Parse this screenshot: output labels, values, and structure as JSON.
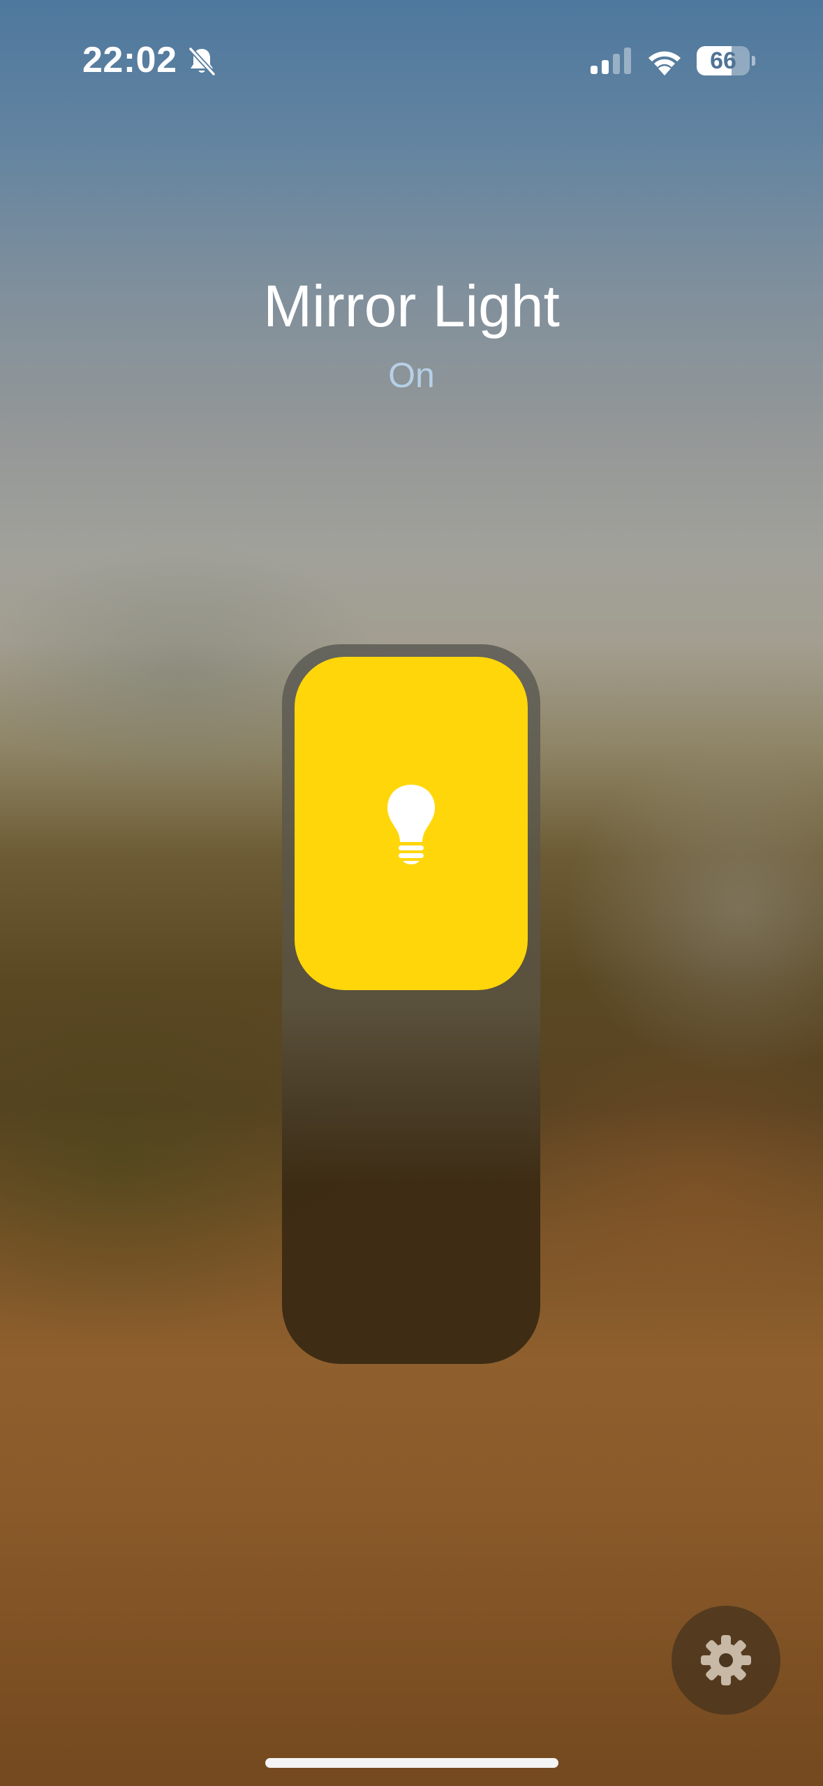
{
  "status_bar": {
    "time": "22:02",
    "battery_percent": "66",
    "battery_level": 0.66,
    "signal_bars_active": 2,
    "signal_bars_total": 4,
    "icons": [
      "bell-slash-icon",
      "cellular-signal-icon",
      "wifi-icon",
      "battery-icon"
    ]
  },
  "accessory": {
    "name": "Mirror Light",
    "state": "On",
    "brightness_level": 0.48,
    "icon": "lightbulb-icon"
  },
  "controls": {
    "settings_icon": "gear-icon"
  },
  "colors": {
    "accent_on": "#ffd60a",
    "status_text": "#b6d0e6"
  }
}
